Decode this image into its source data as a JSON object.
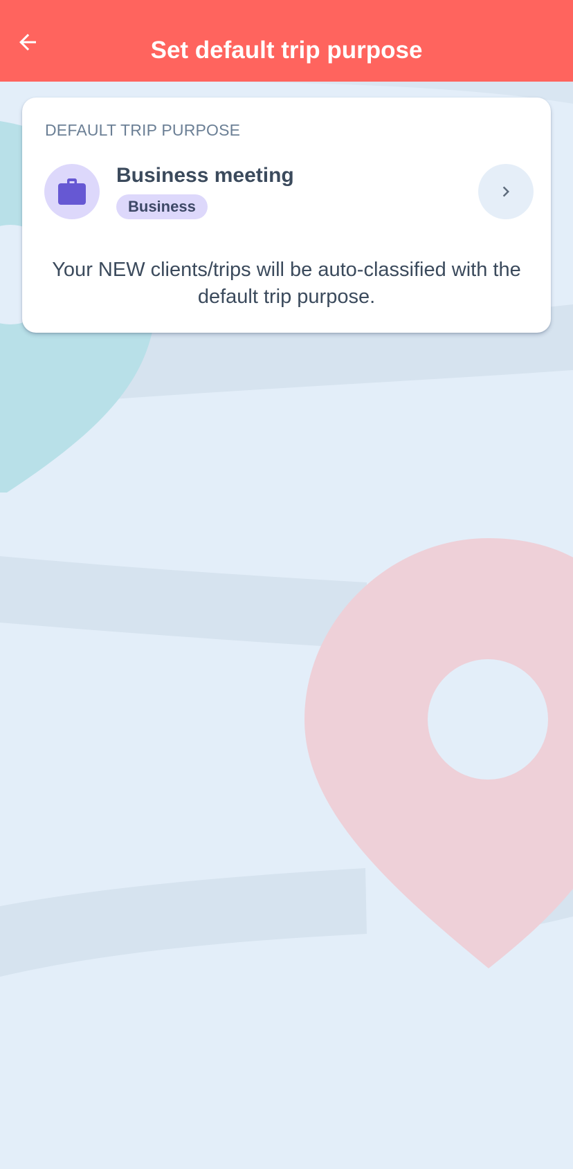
{
  "header": {
    "title": "Set default trip purpose",
    "back_icon": "arrow-left-icon",
    "background_color": "#ff645e"
  },
  "card": {
    "section_label": "DEFAULT TRIP PURPOSE",
    "purpose": {
      "name": "Business meeting",
      "category": "Business",
      "icon": "briefcase-icon",
      "icon_color": "#6658d3",
      "icon_bg_color": "#ddd8fb",
      "action_icon": "chevron-right-icon"
    },
    "description": "Your NEW clients/trips will be auto-classified with the default trip purpose."
  },
  "background": {
    "color": "#e3eef9",
    "decorations": [
      "map-pin-teal",
      "map-pin-pink",
      "road-bands"
    ]
  }
}
